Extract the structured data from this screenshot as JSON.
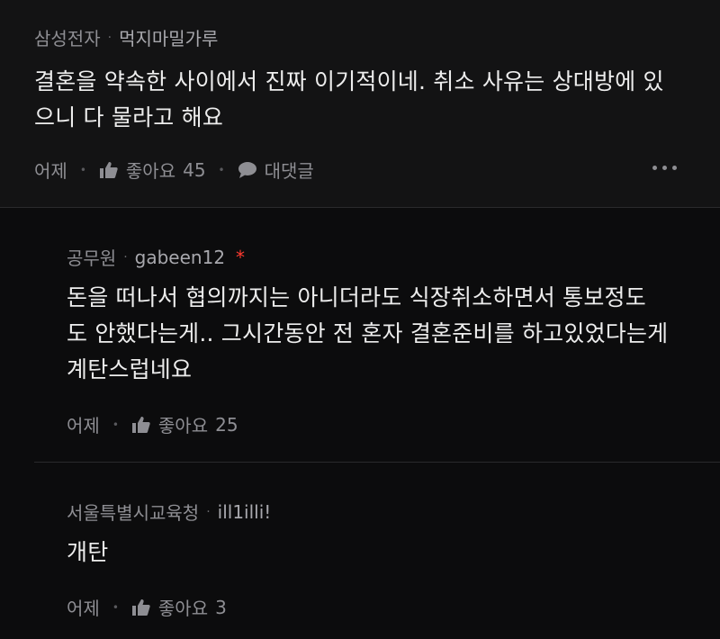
{
  "comments": [
    {
      "org": "삼성전자",
      "nickname": "먹지마밀가루",
      "lines": [
        "결혼을 약속한 사이에서 진짜 이기적이네. 취소 사유는 상대방에 있",
        "으니 다 물라고 해요"
      ],
      "time": "어제",
      "like_label": "좋아요",
      "like_count": "45",
      "reply_label": "대댓글"
    },
    {
      "org": "공무원",
      "nickname": "gabeen12",
      "new_mark": "*",
      "lines": [
        "돈을 떠나서 협의까지는 아니더라도 식장취소하면서 통보정도",
        "도 안했다는게.. 그시간동안 전 혼자 결혼준비를 하고있었다는게",
        "계탄스럽네요"
      ],
      "time": "어제",
      "like_label": "좋아요",
      "like_count": "25"
    },
    {
      "org": "서울특별시교육청",
      "nickname": "ill1illi!",
      "lines": [
        "개탄"
      ],
      "time": "어제",
      "like_label": "좋아요",
      "like_count": "3"
    }
  ],
  "icons": {
    "like": "thumbs-up-icon",
    "reply": "speech-bubble-icon",
    "more": "more-dots-icon"
  },
  "colors": {
    "background": "#0c0c0d",
    "top_card": "#131314",
    "meta": "#8e8e93",
    "new_mark": "#ff3b30"
  }
}
